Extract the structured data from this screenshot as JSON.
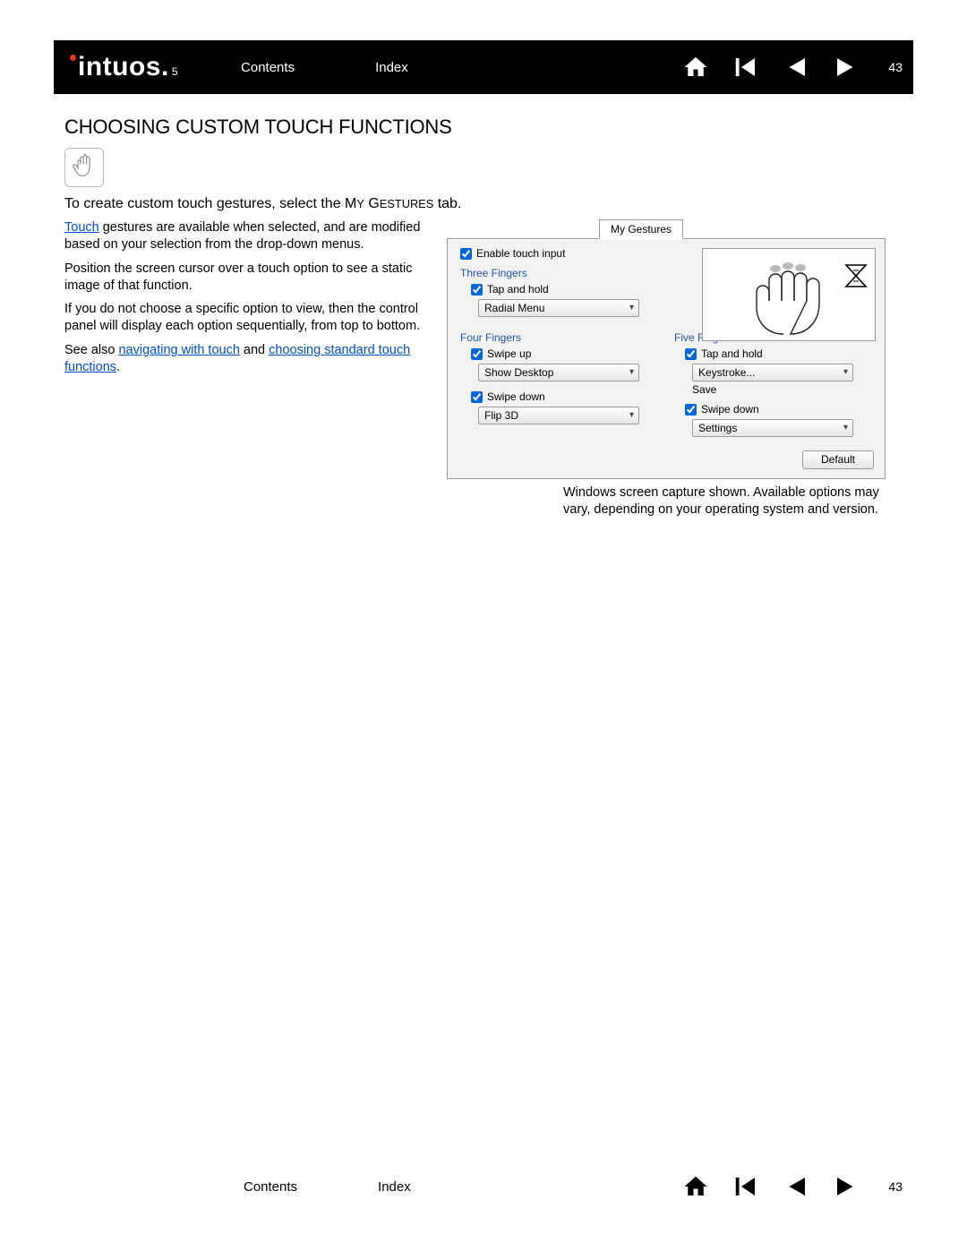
{
  "brand": {
    "name": "intuos",
    "version": "5"
  },
  "nav": {
    "contents": "Contents",
    "index": "Index",
    "page": "43"
  },
  "heading": "CHOOSING CUSTOM TOUCH FUNCTIONS",
  "intro_prefix": "To create custom touch gestures, select the ",
  "intro_tab_1": "M",
  "intro_tab_2": "Y",
  "intro_tab_3": " G",
  "intro_tab_4": "ESTURES",
  "intro_suffix": " tab.",
  "left": {
    "p1_link": "Touch",
    "p1_rest": " gestures are available when selected, and are modified based on your selection from the drop-down menus.",
    "p2": "Position the screen cursor over a touch option to see a static image of that function.",
    "p3": "If you do not choose a specific option to view, then the control panel will display each option sequentially, from top to bottom.",
    "p4_prefix": "See also ",
    "p4_link1": "navigating with touch",
    "p4_mid": " and ",
    "p4_link2": "choosing standard touch functions",
    "p4_suffix": "."
  },
  "panel": {
    "tab": "My Gestures",
    "enable": "Enable touch input",
    "three": {
      "label": "Three Fingers",
      "tap_hold": "Tap and hold",
      "dd1": "Radial Menu"
    },
    "four": {
      "label": "Four Fingers",
      "swipe_up": "Swipe up",
      "dd_up": "Show Desktop",
      "swipe_down": "Swipe down",
      "dd_down": "Flip 3D"
    },
    "five": {
      "label": "Five Fingers",
      "tap_hold": "Tap and hold",
      "dd_tap": "Keystroke...",
      "save": "Save",
      "swipe_down": "Swipe down",
      "dd_down": "Settings"
    },
    "default_btn": "Default"
  },
  "caption": "Windows screen capture shown. Available options may vary, depending on your operating system and version."
}
